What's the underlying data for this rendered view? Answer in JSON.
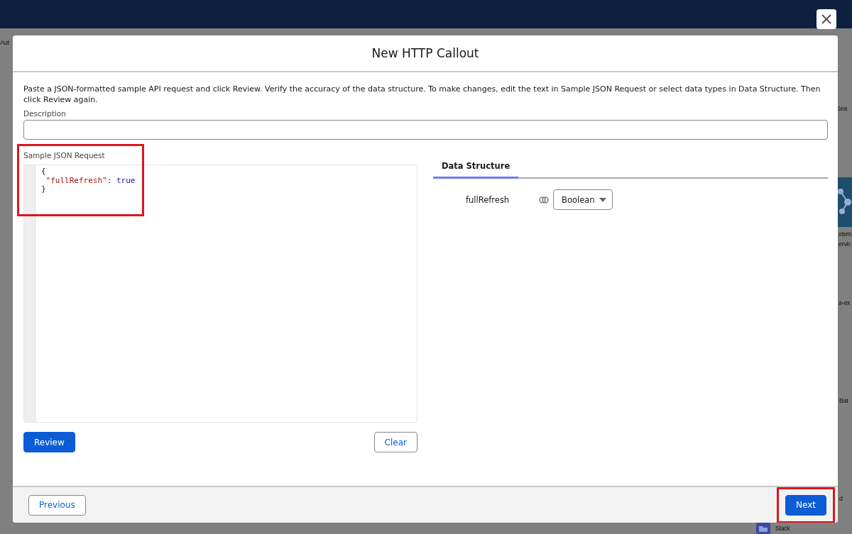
{
  "background": {
    "fragments": [
      "Aut",
      "Sea",
      "xtern",
      "ervic",
      "a-ex",
      "Bat",
      "d",
      "Slack"
    ]
  },
  "dialog": {
    "title": "New HTTP Callout",
    "instructions": "Paste a JSON-formatted sample API request and click Review. Verify the accuracy of the data structure. To make changes, edit the text in Sample JSON Request or select data types in Data Structure. Then click Review again.",
    "description": {
      "label": "Description"
    },
    "sample": {
      "label": "Sample JSON Request",
      "highlighted": true,
      "lines": [
        {
          "tokens": [
            {
              "kind": "punct",
              "text": "{"
            }
          ],
          "children": [
            {
              "tokens": [
                {
                  "kind": "string",
                  "text": "\"fullRefresh\""
                },
                {
                  "kind": "punct",
                  "text": ": "
                },
                {
                  "kind": "keyword",
                  "text": "true"
                }
              ]
            }
          ]
        },
        {
          "tokens": [
            {
              "kind": "punct",
              "text": "}"
            }
          ]
        }
      ]
    },
    "buttons": [
      {
        "label": "Review",
        "kind": "brand"
      },
      {
        "label": "Clear",
        "kind": "neutral"
      }
    ],
    "tabs": [
      {
        "label": "Data Structure",
        "selected": true
      }
    ],
    "fields": [
      {
        "name": "fullRefresh",
        "type": "Boolean"
      }
    ],
    "footer": [
      {
        "label": "Previous",
        "kind": "neutral",
        "highlighted": false
      },
      {
        "label": "Next",
        "kind": "brand",
        "highlighted": true
      }
    ]
  }
}
